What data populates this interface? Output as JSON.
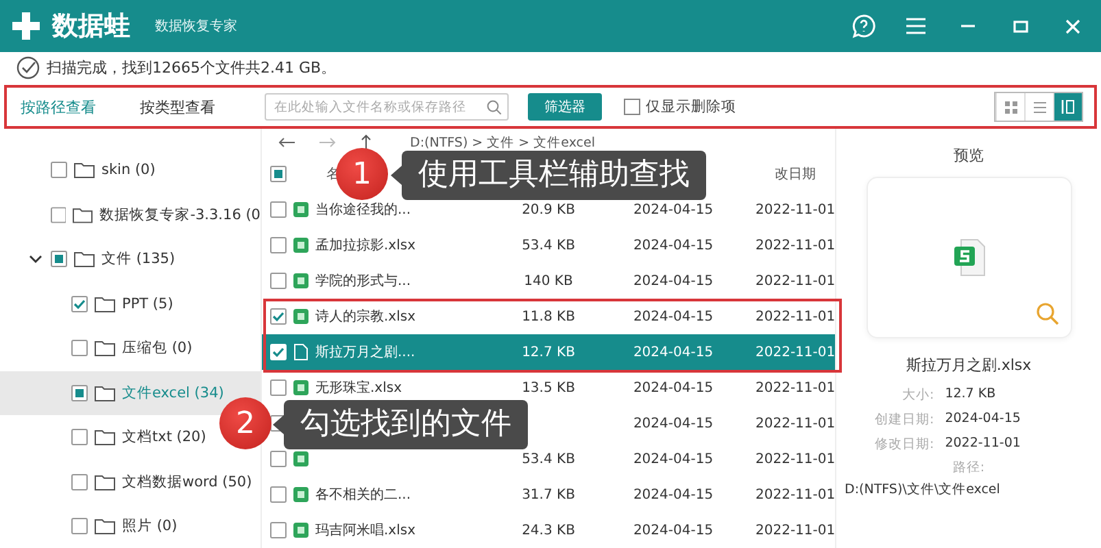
{
  "window": {
    "logo": "数据蛙",
    "subtitle": "数据恢复专家"
  },
  "status": {
    "text": "扫描完成，找到12665个文件共2.41 GB。"
  },
  "toolbar": {
    "tabs": [
      {
        "label": "按路径查看",
        "selected": true
      },
      {
        "label": "按类型查看",
        "selected": false
      }
    ],
    "search": {
      "placeholder": "在此处输入文件名称或保存路径"
    },
    "filter_button": "筛选器",
    "deleted_only": {
      "label": "仅显示删除项",
      "checked": false
    },
    "views": [
      {
        "kind": "grid",
        "selected": false
      },
      {
        "kind": "list",
        "selected": false
      },
      {
        "kind": "detail",
        "selected": true
      }
    ]
  },
  "tree": [
    {
      "label": "skin (0)",
      "checked": false,
      "partial": false,
      "selected": false
    },
    {
      "label": "数据恢复专家-3.3.16 (0",
      "checked": false,
      "partial": false,
      "selected": false
    },
    {
      "label": "文件 (135)",
      "checked": false,
      "partial": true,
      "selected": false,
      "expanded": true,
      "children": [
        {
          "label": "PPT (5)",
          "checked": true,
          "partial": false,
          "selected": false
        },
        {
          "label": "压缩包 (0)",
          "checked": false,
          "partial": false,
          "selected": false
        },
        {
          "label": "文件excel (34)",
          "checked": false,
          "partial": true,
          "selected": true
        },
        {
          "label": "文档txt (20)",
          "checked": false,
          "partial": false,
          "selected": false
        },
        {
          "label": "文档数据word (50)",
          "checked": false,
          "partial": false,
          "selected": false
        },
        {
          "label": "照片 (0)",
          "checked": false,
          "partial": false,
          "selected": false
        }
      ]
    }
  ],
  "list": {
    "breadcrumb": "D:(NTFS) > 文件 > 文件excel",
    "header_checked": false,
    "header_partial": true,
    "name_column": "名",
    "modified_column": "改日期",
    "rows": [
      {
        "name": "当你途径我的...",
        "size": "20.9 KB",
        "created": "2024-04-15",
        "modified": "2022-11-01",
        "checked": false,
        "selected": false
      },
      {
        "name": "孟加拉掠影.xlsx",
        "size": "53.4 KB",
        "created": "2024-04-15",
        "modified": "2022-11-01",
        "checked": false,
        "selected": false
      },
      {
        "name": "学院的形式与...",
        "size": "140 KB",
        "created": "2024-04-15",
        "modified": "2022-11-01",
        "checked": false,
        "selected": false
      },
      {
        "name": "诗人的宗教.xlsx",
        "size": "11.8 KB",
        "created": "2024-04-15",
        "modified": "2022-11-01",
        "checked": true,
        "selected": false
      },
      {
        "name": "斯拉万月之剧....",
        "size": "12.7 KB",
        "created": "2024-04-15",
        "modified": "2022-11-01",
        "checked": true,
        "selected": true
      },
      {
        "name": "无形珠宝.xlsx",
        "size": "13.5 KB",
        "created": "2024-04-15",
        "modified": "2022-11-01",
        "checked": false,
        "selected": false
      },
      {
        "created": "2024-04-15",
        "modified": "2022-11-01",
        "checked": false,
        "selected": false
      },
      {
        "size": "53.4 KB",
        "created": "2024-04-15",
        "modified": "2022-11-01",
        "checked": false,
        "selected": false
      },
      {
        "name": "各不相关的二...",
        "size": "31.7 KB",
        "created": "2024-04-15",
        "modified": "2022-11-01",
        "checked": false,
        "selected": false
      },
      {
        "name": "玛吉阿米唱.xlsx",
        "size": "24.3 KB",
        "created": "2024-04-15",
        "modified": "2022-11-01",
        "checked": false,
        "selected": false
      }
    ]
  },
  "preview": {
    "title": "预览",
    "file_name": "斯拉万月之剧.xlsx",
    "details": [
      {
        "label": "大小:",
        "value": "12.7 KB"
      },
      {
        "label": "创建日期:",
        "value": "2024-04-15"
      },
      {
        "label": "修改日期:",
        "value": "2022-11-01"
      }
    ],
    "path_label": "路径:",
    "path": "D:(NTFS)\\文件\\文件excel"
  },
  "callouts": [
    {
      "number": "1",
      "text": "使用工具栏辅助查找"
    },
    {
      "number": "2",
      "text": "勾选找到的文件"
    }
  ]
}
